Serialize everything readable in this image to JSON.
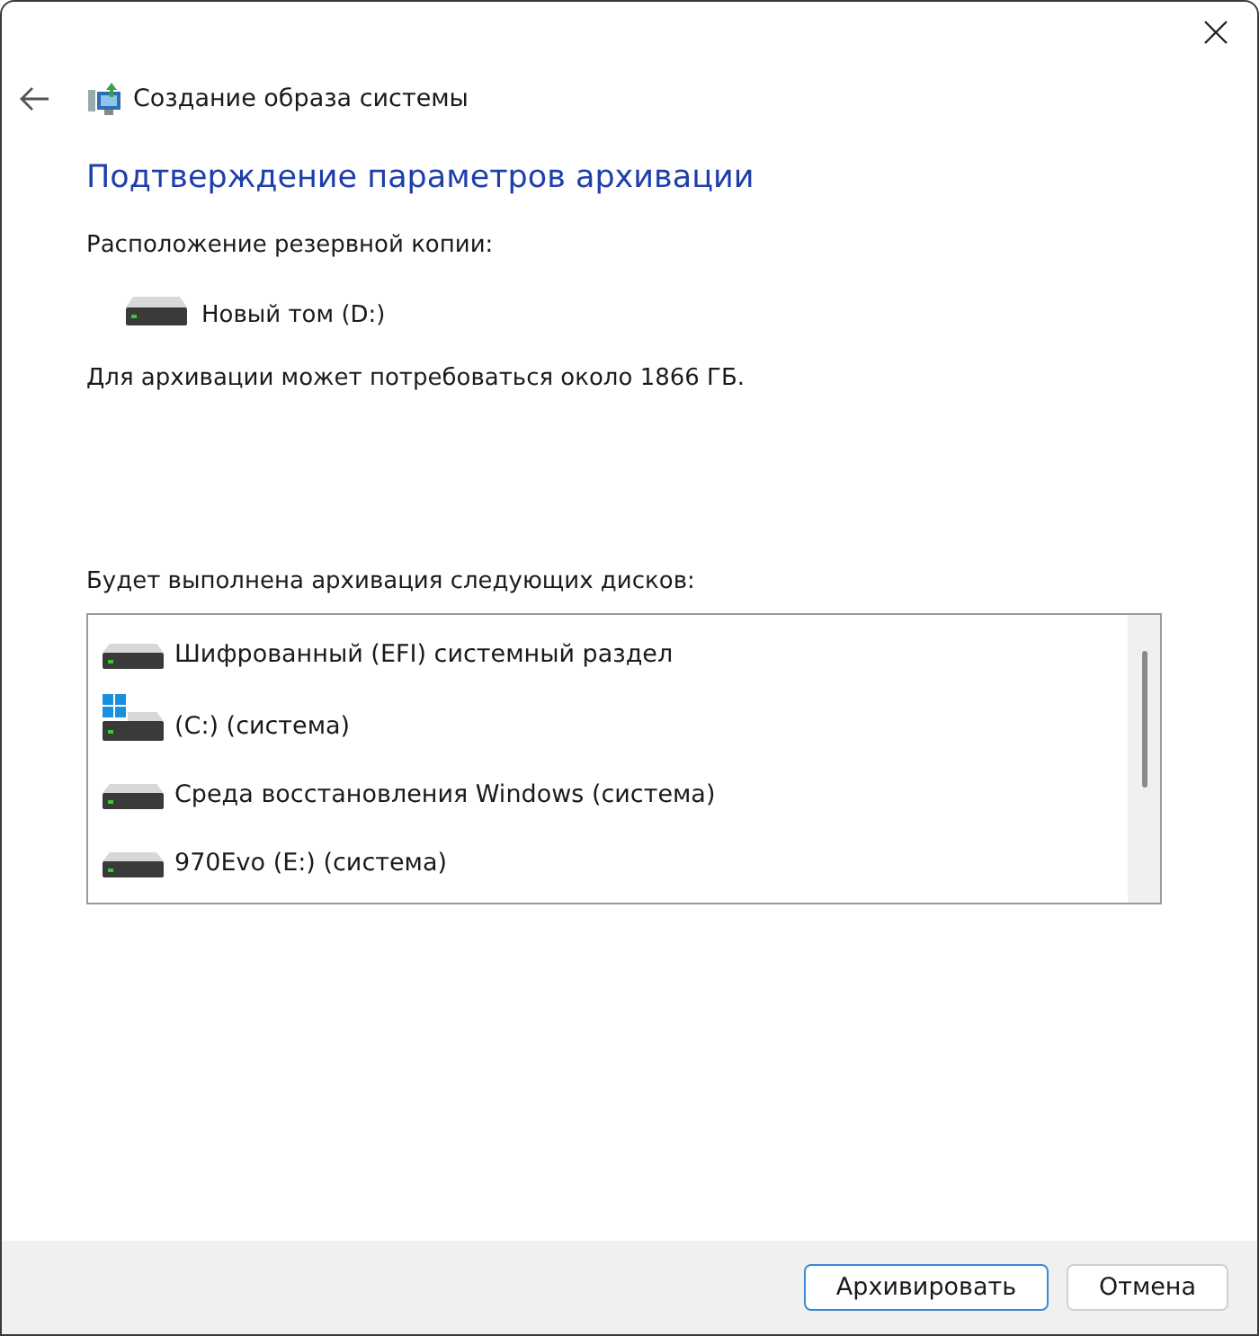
{
  "window": {
    "title": "Создание образа системы"
  },
  "heading": "Подтверждение параметров архивации",
  "location_label": "Расположение резервной копии:",
  "location": {
    "kind": "drive",
    "name": "Новый том (D:)"
  },
  "size_note": "Для архивации может потребоваться около 1866 ГБ.",
  "disks_label": "Будет выполнена архивация следующих дисков:",
  "disks": [
    {
      "kind": "drive",
      "name": "Шифрованный (EFI) системный раздел"
    },
    {
      "kind": "system",
      "name": "(C:) (система)"
    },
    {
      "kind": "drive",
      "name": "Среда восстановления Windows (система)"
    },
    {
      "kind": "drive",
      "name": "970Evo (E:) (система)"
    }
  ],
  "buttons": [
    {
      "label": "Архивировать",
      "kind": "primary"
    },
    {
      "label": "Отмена",
      "kind": "secondary"
    }
  ]
}
